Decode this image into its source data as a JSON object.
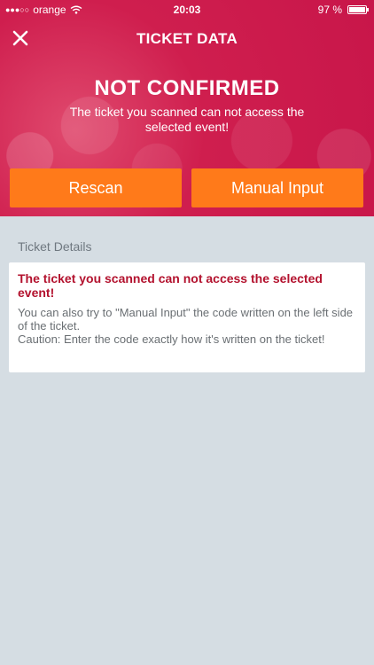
{
  "status_bar": {
    "carrier": "orange",
    "time": "20:03",
    "battery": "97 %"
  },
  "nav": {
    "title": "TICKET DATA"
  },
  "result": {
    "heading": "NOT CONFIRMED",
    "message": "The ticket you scanned can not access the selected event!"
  },
  "actions": {
    "rescan_label": "Rescan",
    "manual_label": "Manual Input"
  },
  "details": {
    "section_label": "Ticket Details",
    "error_title": "The ticket you scanned can not access the selected event!",
    "hint": "You can also try to \"Manual Input\" the code written on the left side of the ticket.",
    "caution": "Caution: Enter the code exactly how it's written on the ticket!"
  },
  "colors": {
    "hero": "#c8164a",
    "button": "#ff7a1a",
    "error_text": "#b3122e",
    "background": "#d5dde3"
  }
}
